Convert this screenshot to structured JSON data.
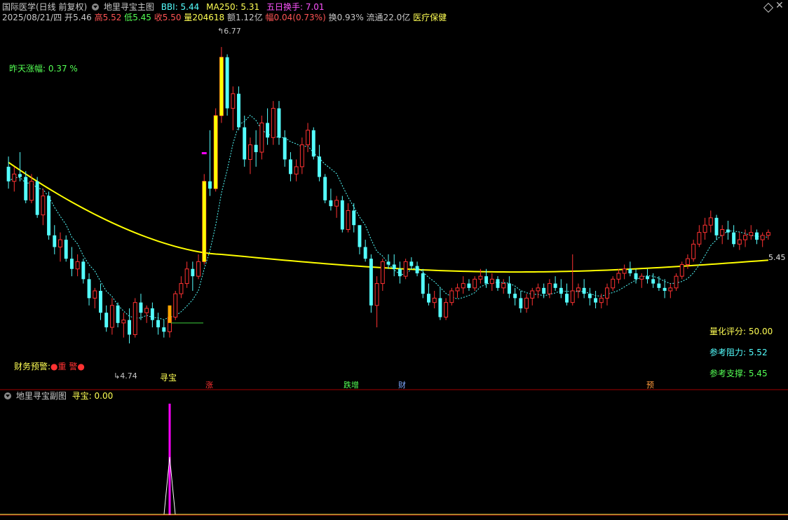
{
  "header": {
    "security_name": "国际医学(日线 前复权)",
    "indicator_name": "地里寻宝主图",
    "bbi_label": "BBI: 5.44",
    "ma250_label": "MA250: 5.31",
    "turnover5_label": "五日换手: 7.01",
    "date": "2025/08/21/四",
    "open_label": "开",
    "open": "5.46",
    "high_label": "高",
    "high": "5.52",
    "low_label": "低",
    "low": "5.45",
    "close_label": "收",
    "close": "5.50",
    "vol_label": "量",
    "vol": "204618",
    "amount_label": "额",
    "amount": "1.12亿",
    "change_label": "幅",
    "change": "0.04(0.73%)",
    "turnover_label": "换",
    "turnover": "0.93%",
    "float_label": "流通",
    "float": "22.0亿",
    "sector": "医疗保健"
  },
  "main_panel": {
    "prev_change": "昨天涨幅: 0.37 %",
    "high_marker": "6.77",
    "low_marker": "4.74",
    "last_price": "5.45",
    "xunbao_label": "寻宝",
    "finance_warning_label": "财务预警:",
    "finance_warning_value": "●重 警●",
    "quant_score": "量化评分: 50.00",
    "ref_resist": "参考阻力: 5.52",
    "ref_support": "参考支撑: 5.45",
    "event_tags": [
      "涨",
      "跌增",
      "财",
      "预"
    ]
  },
  "sub_panel": {
    "indicator_name": "地里寻宝副图",
    "value_label": "寻宝: 0.00"
  },
  "colors": {
    "up": "#ff3232",
    "down": "#54ffff",
    "ma250": "#ffff00",
    "bbi": "#54ffff",
    "signal": "#ff00ff",
    "highlight": "#ffff00"
  },
  "chart_data": {
    "type": "candlestick",
    "ohlc": [
      [
        5.95,
        6.02,
        5.8,
        5.85
      ],
      [
        5.85,
        5.95,
        5.78,
        5.9
      ],
      [
        5.9,
        6.05,
        5.85,
        5.88
      ],
      [
        5.88,
        5.92,
        5.7,
        5.72
      ],
      [
        5.72,
        5.9,
        5.7,
        5.85
      ],
      [
        5.85,
        5.88,
        5.6,
        5.62
      ],
      [
        5.62,
        5.8,
        5.55,
        5.75
      ],
      [
        5.75,
        5.78,
        5.45,
        5.48
      ],
      [
        5.48,
        5.55,
        5.35,
        5.4
      ],
      [
        5.4,
        5.5,
        5.3,
        5.45
      ],
      [
        5.45,
        5.48,
        5.3,
        5.32
      ],
      [
        5.32,
        5.4,
        5.2,
        5.25
      ],
      [
        5.25,
        5.35,
        5.2,
        5.3
      ],
      [
        5.3,
        5.32,
        5.15,
        5.18
      ],
      [
        5.18,
        5.22,
        5.0,
        5.05
      ],
      [
        5.05,
        5.12,
        4.98,
        5.1
      ],
      [
        5.1,
        5.15,
        4.9,
        4.95
      ],
      [
        4.95,
        5.0,
        4.82,
        4.85
      ],
      [
        4.85,
        5.05,
        4.8,
        5.0
      ],
      [
        5.0,
        5.02,
        4.85,
        4.88
      ],
      [
        4.88,
        4.95,
        4.78,
        4.9
      ],
      [
        4.9,
        4.98,
        4.74,
        4.8
      ],
      [
        4.8,
        5.05,
        4.78,
        5.02
      ],
      [
        5.02,
        5.08,
        4.9,
        4.95
      ],
      [
        4.95,
        5.0,
        4.88,
        4.98
      ],
      [
        4.98,
        5.02,
        4.85,
        4.9
      ],
      [
        4.9,
        4.95,
        4.8,
        4.85
      ],
      [
        4.85,
        4.9,
        4.78,
        4.82
      ],
      [
        4.82,
        4.95,
        4.78,
        4.92
      ],
      [
        4.92,
        5.1,
        4.9,
        5.08
      ],
      [
        5.08,
        5.2,
        5.05,
        5.15
      ],
      [
        5.15,
        5.3,
        5.12,
        5.25
      ],
      [
        5.25,
        5.3,
        5.1,
        5.2
      ],
      [
        5.2,
        5.35,
        5.18,
        5.3
      ],
      [
        5.3,
        5.9,
        5.28,
        5.85
      ],
      [
        5.85,
        6.2,
        5.75,
        5.8
      ],
      [
        5.8,
        6.35,
        5.78,
        6.3
      ],
      [
        6.3,
        6.77,
        6.25,
        6.7
      ],
      [
        6.7,
        6.72,
        6.3,
        6.35
      ],
      [
        6.35,
        6.5,
        6.2,
        6.45
      ],
      [
        6.45,
        6.5,
        6.2,
        6.22
      ],
      [
        6.22,
        6.3,
        5.95,
        6.0
      ],
      [
        6.0,
        6.15,
        5.9,
        6.1
      ],
      [
        6.1,
        6.2,
        5.95,
        6.05
      ],
      [
        6.05,
        6.3,
        6.0,
        6.25
      ],
      [
        6.25,
        6.35,
        6.1,
        6.15
      ],
      [
        6.15,
        6.4,
        6.1,
        6.35
      ],
      [
        6.35,
        6.4,
        6.1,
        6.15
      ],
      [
        6.15,
        6.2,
        5.95,
        6.0
      ],
      [
        6.0,
        6.05,
        5.85,
        5.9
      ],
      [
        5.9,
        6.0,
        5.85,
        5.95
      ],
      [
        5.95,
        6.15,
        5.9,
        6.1
      ],
      [
        6.1,
        6.25,
        6.05,
        6.2
      ],
      [
        6.2,
        6.22,
        6.0,
        6.02
      ],
      [
        6.02,
        6.1,
        5.85,
        5.88
      ],
      [
        5.88,
        5.9,
        5.7,
        5.72
      ],
      [
        5.72,
        5.8,
        5.65,
        5.68
      ],
      [
        5.68,
        5.75,
        5.6,
        5.72
      ],
      [
        5.72,
        5.75,
        5.5,
        5.52
      ],
      [
        5.52,
        5.7,
        5.5,
        5.65
      ],
      [
        5.65,
        5.7,
        5.5,
        5.55
      ],
      [
        5.55,
        5.4,
        5.35,
        5.4
      ],
      [
        5.4,
        5.45,
        5.3,
        5.32
      ],
      [
        5.32,
        5.35,
        4.95,
        5.0
      ],
      [
        5.0,
        5.2,
        4.85,
        5.15
      ],
      [
        5.15,
        5.32,
        5.1,
        5.3
      ],
      [
        5.3,
        5.35,
        5.25,
        5.28
      ],
      [
        5.28,
        5.35,
        5.2,
        5.25
      ],
      [
        5.25,
        5.3,
        5.15,
        5.2
      ],
      [
        5.2,
        5.32,
        5.18,
        5.3
      ],
      [
        5.3,
        5.33,
        5.25,
        5.27
      ],
      [
        5.27,
        5.3,
        5.2,
        5.22
      ],
      [
        5.22,
        5.25,
        5.05,
        5.08
      ],
      [
        5.08,
        5.15,
        5.0,
        5.02
      ],
      [
        5.02,
        5.1,
        4.98,
        5.05
      ],
      [
        5.05,
        5.12,
        4.9,
        4.92
      ],
      [
        4.92,
        5.05,
        4.9,
        5.02
      ],
      [
        5.02,
        5.12,
        5.0,
        5.1
      ],
      [
        5.1,
        5.15,
        5.05,
        5.12
      ],
      [
        5.12,
        5.2,
        5.08,
        5.15
      ],
      [
        5.15,
        5.18,
        5.1,
        5.12
      ],
      [
        5.12,
        5.2,
        5.1,
        5.18
      ],
      [
        5.18,
        5.25,
        5.15,
        5.2
      ],
      [
        5.2,
        5.25,
        5.12,
        5.15
      ],
      [
        5.15,
        5.22,
        5.1,
        5.18
      ],
      [
        5.18,
        5.2,
        5.1,
        5.12
      ],
      [
        5.12,
        5.18,
        5.08,
        5.15
      ],
      [
        5.15,
        5.2,
        5.05,
        5.08
      ],
      [
        5.08,
        5.12,
        5.0,
        5.05
      ],
      [
        5.05,
        5.1,
        4.95,
        4.98
      ],
      [
        4.98,
        5.08,
        4.95,
        5.05
      ],
      [
        5.05,
        5.12,
        5.0,
        5.1
      ],
      [
        5.1,
        5.15,
        5.05,
        5.12
      ],
      [
        5.12,
        5.15,
        5.05,
        5.08
      ],
      [
        5.08,
        5.18,
        5.05,
        5.15
      ],
      [
        5.15,
        5.2,
        5.1,
        5.12
      ],
      [
        5.12,
        5.18,
        5.05,
        5.08
      ],
      [
        5.08,
        5.15,
        5.0,
        5.02
      ],
      [
        5.02,
        5.35,
        5.0,
        5.1
      ],
      [
        5.1,
        5.15,
        5.05,
        5.12
      ],
      [
        5.12,
        5.18,
        5.05,
        5.08
      ],
      [
        5.08,
        5.12,
        5.0,
        5.05
      ],
      [
        5.05,
        5.1,
        4.98,
        5.02
      ],
      [
        5.02,
        5.08,
        4.98,
        5.05
      ],
      [
        5.05,
        5.15,
        5.0,
        5.12
      ],
      [
        5.12,
        5.2,
        5.1,
        5.18
      ],
      [
        5.18,
        5.25,
        5.15,
        5.22
      ],
      [
        5.22,
        5.28,
        5.18,
        5.25
      ],
      [
        5.25,
        5.3,
        5.2,
        5.22
      ],
      [
        5.22,
        5.25,
        5.15,
        5.18
      ],
      [
        5.18,
        5.22,
        5.12,
        5.2
      ],
      [
        5.2,
        5.25,
        5.15,
        5.18
      ],
      [
        5.18,
        5.22,
        5.12,
        5.15
      ],
      [
        5.15,
        5.2,
        5.1,
        5.12
      ],
      [
        5.12,
        5.18,
        5.05,
        5.1
      ],
      [
        5.1,
        5.15,
        5.05,
        5.12
      ],
      [
        5.12,
        5.22,
        5.1,
        5.2
      ],
      [
        5.2,
        5.3,
        5.18,
        5.28
      ],
      [
        5.28,
        5.35,
        5.25,
        5.32
      ],
      [
        5.32,
        5.45,
        5.3,
        5.42
      ],
      [
        5.42,
        5.55,
        5.4,
        5.5
      ],
      [
        5.5,
        5.6,
        5.45,
        5.55
      ],
      [
        5.55,
        5.65,
        5.5,
        5.6
      ],
      [
        5.6,
        5.62,
        5.45,
        5.48
      ],
      [
        5.48,
        5.55,
        5.42,
        5.52
      ],
      [
        5.52,
        5.58,
        5.45,
        5.5
      ],
      [
        5.5,
        5.55,
        5.4,
        5.42
      ],
      [
        5.42,
        5.5,
        5.38,
        5.45
      ],
      [
        5.45,
        5.52,
        5.4,
        5.48
      ],
      [
        5.48,
        5.55,
        5.45,
        5.5
      ],
      [
        5.5,
        5.52,
        5.42,
        5.45
      ],
      [
        5.45,
        5.5,
        5.4,
        5.48
      ],
      [
        5.48,
        5.52,
        5.45,
        5.5
      ]
    ],
    "ma250_end": 5.31,
    "bbi_end": 5.44,
    "ylim": [
      4.5,
      6.9
    ]
  }
}
